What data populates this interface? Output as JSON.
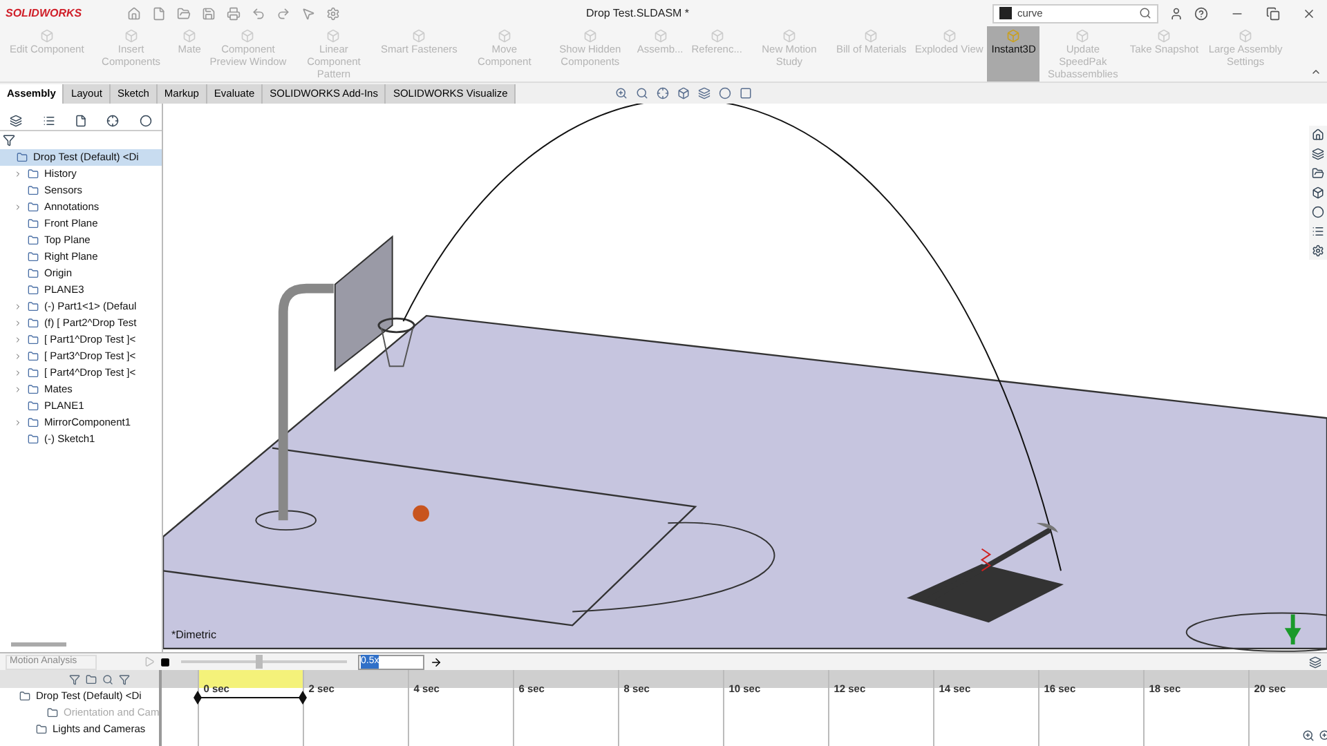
{
  "app": {
    "logo": "SOLIDWORKS",
    "title": "Drop Test.SLDASM *",
    "search": {
      "value": "curve"
    }
  },
  "ribbon": [
    {
      "label": "Edit Component",
      "disabled": true,
      "selected": false
    },
    {
      "label": "Insert Components",
      "disabled": true,
      "selected": false
    },
    {
      "label": "Mate",
      "disabled": true,
      "selected": false
    },
    {
      "label": "Component Preview Window",
      "disabled": true,
      "selected": false
    },
    {
      "label": "Linear Component Pattern",
      "disabled": true,
      "selected": false
    },
    {
      "label": "Smart Fasteners",
      "disabled": true,
      "selected": false
    },
    {
      "label": "Move Component",
      "disabled": true,
      "selected": false
    },
    {
      "label": "Show Hidden Components",
      "disabled": true,
      "selected": false
    },
    {
      "label": "Assemb...",
      "disabled": true,
      "selected": false
    },
    {
      "label": "Referenc...",
      "disabled": true,
      "selected": false
    },
    {
      "label": "New Motion Study",
      "disabled": true,
      "selected": false
    },
    {
      "label": "Bill of Materials",
      "disabled": true,
      "selected": false
    },
    {
      "label": "Exploded View",
      "disabled": true,
      "selected": false
    },
    {
      "label": "Instant3D",
      "disabled": false,
      "selected": true
    },
    {
      "label": "Update SpeedPak Subassemblies",
      "disabled": true,
      "selected": false
    },
    {
      "label": "Take Snapshot",
      "disabled": true,
      "selected": false
    },
    {
      "label": "Large Assembly Settings",
      "disabled": true,
      "selected": false
    }
  ],
  "tabs": [
    {
      "label": "Assembly",
      "selected": true
    },
    {
      "label": "Layout",
      "selected": false
    },
    {
      "label": "Sketch",
      "selected": false
    },
    {
      "label": "Markup",
      "selected": false
    },
    {
      "label": "Evaluate",
      "selected": false
    },
    {
      "label": "SOLIDWORKS Add-Ins",
      "selected": false
    },
    {
      "label": "SOLIDWORKS Visualize",
      "selected": false
    }
  ],
  "feature_tree": {
    "root": {
      "label": "Drop Test (Default) <Di",
      "selected": true,
      "children": [
        {
          "label": "History",
          "expanded": false
        },
        {
          "label": "Sensors"
        },
        {
          "label": "Annotations",
          "expanded": false
        },
        {
          "label": "Front Plane"
        },
        {
          "label": "Top Plane"
        },
        {
          "label": "Right Plane"
        },
        {
          "label": "Origin"
        },
        {
          "label": "PLANE3"
        },
        {
          "label": "(-) Part1<1> (Defaul",
          "expanded": false
        },
        {
          "label": "(f) [ Part2^Drop Test",
          "expanded": false
        },
        {
          "label": "[ Part1^Drop Test ]<",
          "expanded": false
        },
        {
          "label": "[ Part3^Drop Test ]<",
          "expanded": false
        },
        {
          "label": "[ Part4^Drop Test ]<",
          "expanded": false
        },
        {
          "label": "Mates",
          "expanded": false
        },
        {
          "label": "PLANE1"
        },
        {
          "label": "MirrorComponent1",
          "expanded": false
        },
        {
          "label": "(-) Sketch1"
        }
      ]
    }
  },
  "viewport": {
    "view_label": "*Dimetric"
  },
  "motion_manager": {
    "study_type": "Motion Analysis",
    "speed": "0.5x",
    "slider": {
      "level": 0.47
    },
    "ticks": [
      "0 sec",
      "2 sec",
      "4 sec",
      "6 sec",
      "8 sec",
      "10 sec",
      "12 sec",
      "14 sec",
      "16 sec",
      "18 sec",
      "20 sec"
    ],
    "tree": [
      {
        "label": "Drop Test (Default) <Di",
        "disabled": false
      },
      {
        "label": "Orientation and Cam",
        "disabled": true
      },
      {
        "label": "Lights and Cameras",
        "disabled": false
      }
    ]
  }
}
